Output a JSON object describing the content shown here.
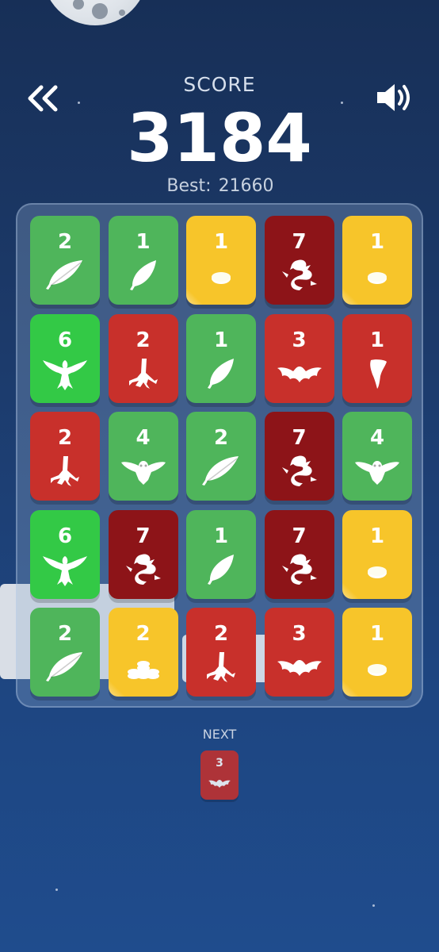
{
  "header": {
    "back_icon": "double-chevron-left-icon",
    "sound_icon": "speaker-on-icon",
    "score_label": "SCORE",
    "score": "3184",
    "best_label": "Best:",
    "best_value": "21660"
  },
  "colors": {
    "green": "#4fb55b",
    "bright_green": "#33c946",
    "yellow": "#f7c52a",
    "red": "#c8302b",
    "dark_red": "#8d1418",
    "background": "#1c3a6a"
  },
  "board": {
    "rows": [
      [
        {
          "value": "2",
          "icon": "feather",
          "color": "green"
        },
        {
          "value": "1",
          "icon": "leaf",
          "color": "green"
        },
        {
          "value": "1",
          "icon": "coin",
          "color": "yellow"
        },
        {
          "value": "7",
          "icon": "dragon",
          "color": "dark_red"
        },
        {
          "value": "1",
          "icon": "coin",
          "color": "yellow"
        }
      ],
      [
        {
          "value": "6",
          "icon": "phoenix",
          "color": "bright_green"
        },
        {
          "value": "2",
          "icon": "claw",
          "color": "red"
        },
        {
          "value": "1",
          "icon": "leaf",
          "color": "green"
        },
        {
          "value": "3",
          "icon": "bat",
          "color": "red"
        },
        {
          "value": "1",
          "icon": "fang",
          "color": "red"
        }
      ],
      [
        {
          "value": "2",
          "icon": "claw",
          "color": "red"
        },
        {
          "value": "4",
          "icon": "owl",
          "color": "green"
        },
        {
          "value": "2",
          "icon": "feather",
          "color": "green"
        },
        {
          "value": "7",
          "icon": "dragon",
          "color": "dark_red"
        },
        {
          "value": "4",
          "icon": "owl",
          "color": "green"
        }
      ],
      [
        {
          "value": "6",
          "icon": "phoenix",
          "color": "bright_green"
        },
        {
          "value": "7",
          "icon": "dragon",
          "color": "dark_red"
        },
        {
          "value": "1",
          "icon": "leaf",
          "color": "green"
        },
        {
          "value": "7",
          "icon": "dragon",
          "color": "dark_red"
        },
        {
          "value": "1",
          "icon": "coin",
          "color": "yellow"
        }
      ],
      [
        {
          "value": "2",
          "icon": "feather",
          "color": "green"
        },
        {
          "value": "2",
          "icon": "coin-stack",
          "color": "yellow"
        },
        {
          "value": "2",
          "icon": "claw",
          "color": "red"
        },
        {
          "value": "3",
          "icon": "bat",
          "color": "red"
        },
        {
          "value": "1",
          "icon": "coin",
          "color": "yellow"
        }
      ]
    ]
  },
  "next": {
    "label": "NEXT",
    "value": "3",
    "icon": "bat",
    "color": "red"
  }
}
